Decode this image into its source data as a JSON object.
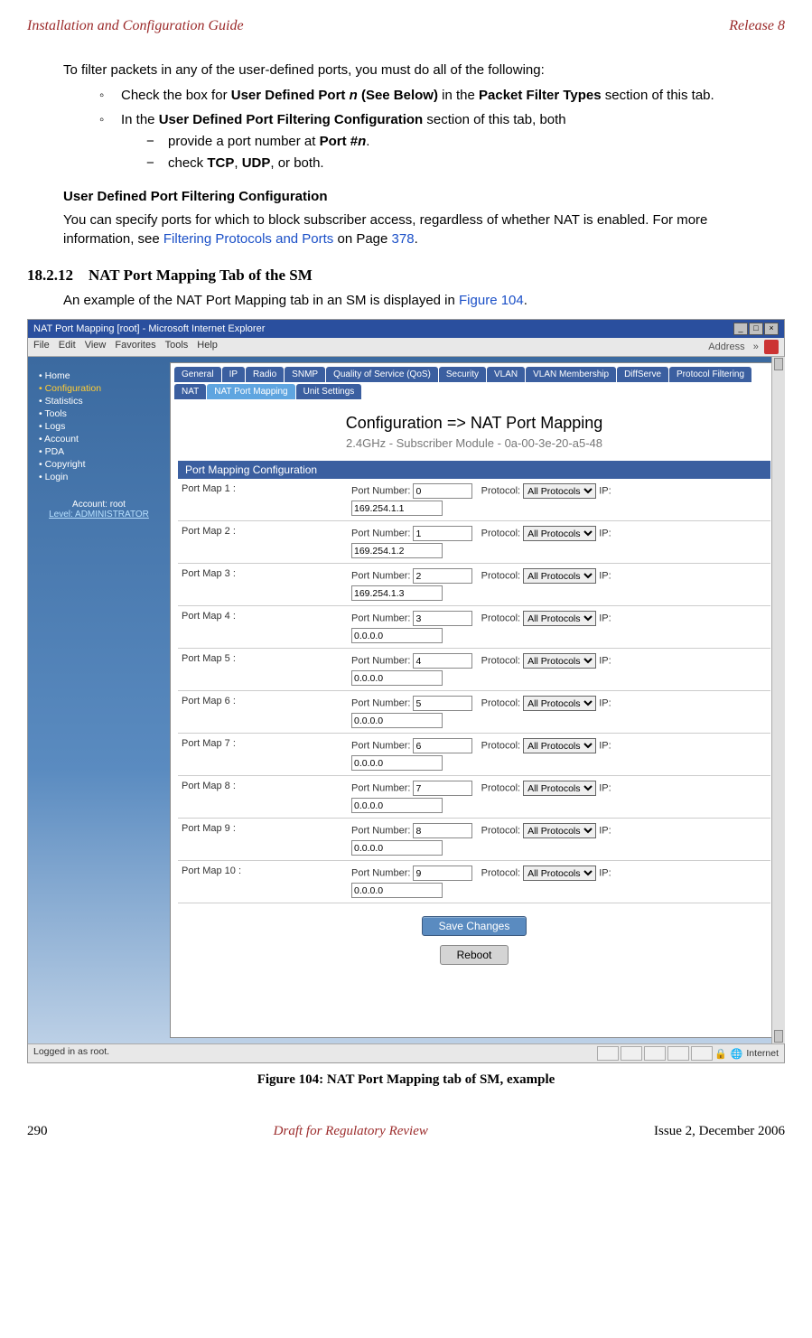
{
  "header": {
    "left": "Installation and Configuration Guide",
    "right": "Release 8"
  },
  "body": {
    "intro": "To filter packets in any of the user-defined ports, you must do all of the following:",
    "bullet1_pre": "Check the box for ",
    "bullet1_bold1": "User Defined Port ",
    "bullet1_em": "n",
    "bullet1_bold2": " (See Below)",
    "bullet1_mid": " in the ",
    "bullet1_bold3": "Packet Filter Types",
    "bullet1_post": " section of this tab.",
    "bullet2_pre": "In the ",
    "bullet2_bold": "User Defined Port Filtering Configuration",
    "bullet2_post": " section of this tab, both",
    "sub1_pre": "provide a port number at ",
    "sub1_bold": "Port #",
    "sub1_em": "n",
    "sub1_post": ".",
    "sub2_pre": "check ",
    "sub2_b1": "TCP",
    "sub2_mid": ", ",
    "sub2_b2": "UDP",
    "sub2_post": ", or both.",
    "subhead": "User Defined Port Filtering Configuration",
    "subpara_pre": "You can specify ports for which to block subscriber access, regardless of whether NAT is enabled. For more information, see ",
    "subpara_link": "Filtering Protocols and Ports",
    "subpara_mid": " on Page ",
    "subpara_page": "378",
    "subpara_post": ".",
    "section_num": "18.2.12",
    "section_title": "NAT Port Mapping Tab of the SM",
    "section_para_pre": "An example of the NAT Port Mapping tab in an SM is displayed in ",
    "section_para_link": "Figure 104",
    "section_para_post": "."
  },
  "screenshot": {
    "titlebar": "NAT Port Mapping [root] - Microsoft Internet Explorer",
    "menus": [
      "File",
      "Edit",
      "View",
      "Favorites",
      "Tools",
      "Help"
    ],
    "address_label": "Address",
    "sidebar_items": [
      "Home",
      "Configuration",
      "Statistics",
      "Tools",
      "Logs",
      "Account",
      "PDA",
      "Copyright",
      "Login"
    ],
    "account_line1": "Account: root",
    "account_line2": "Level: ADMINISTRATOR",
    "tabs_row1": [
      "General",
      "IP",
      "Radio",
      "SNMP",
      "Quality of Service (QoS)",
      "Security",
      "VLAN",
      "VLAN Membership",
      "DiffServe",
      "Protocol Filtering",
      "NAT"
    ],
    "tab_active": "NAT Port Mapping",
    "tabs_row1_after": [
      "Unit Settings"
    ],
    "page_title": "Configuration => NAT Port Mapping",
    "page_sub": "2.4GHz - Subscriber Module - 0a-00-3e-20-a5-48",
    "section_bar": "Port Mapping Configuration",
    "labels": {
      "port_number": "Port Number:",
      "protocol": "Protocol:",
      "ip_suffix": "IP:"
    },
    "protocol_option": "All Protocols",
    "port_maps": [
      {
        "label": "Port Map 1 :",
        "port": "0",
        "ip": "169.254.1.1"
      },
      {
        "label": "Port Map 2 :",
        "port": "1",
        "ip": "169.254.1.2"
      },
      {
        "label": "Port Map 3 :",
        "port": "2",
        "ip": "169.254.1.3"
      },
      {
        "label": "Port Map 4 :",
        "port": "3",
        "ip": "0.0.0.0"
      },
      {
        "label": "Port Map 5 :",
        "port": "4",
        "ip": "0.0.0.0"
      },
      {
        "label": "Port Map 6 :",
        "port": "5",
        "ip": "0.0.0.0"
      },
      {
        "label": "Port Map 7 :",
        "port": "6",
        "ip": "0.0.0.0"
      },
      {
        "label": "Port Map 8 :",
        "port": "7",
        "ip": "0.0.0.0"
      },
      {
        "label": "Port Map 9 :",
        "port": "8",
        "ip": "0.0.0.0"
      },
      {
        "label": "Port Map 10 :",
        "port": "9",
        "ip": "0.0.0.0"
      }
    ],
    "save_btn": "Save Changes",
    "reboot_btn": "Reboot",
    "status_left": "Logged in as root.",
    "status_right": "Internet"
  },
  "figure_caption": "Figure 104: NAT Port Mapping tab of SM, example",
  "footer": {
    "left": "290",
    "center": "Draft for Regulatory Review",
    "right": "Issue 2, December 2006"
  }
}
